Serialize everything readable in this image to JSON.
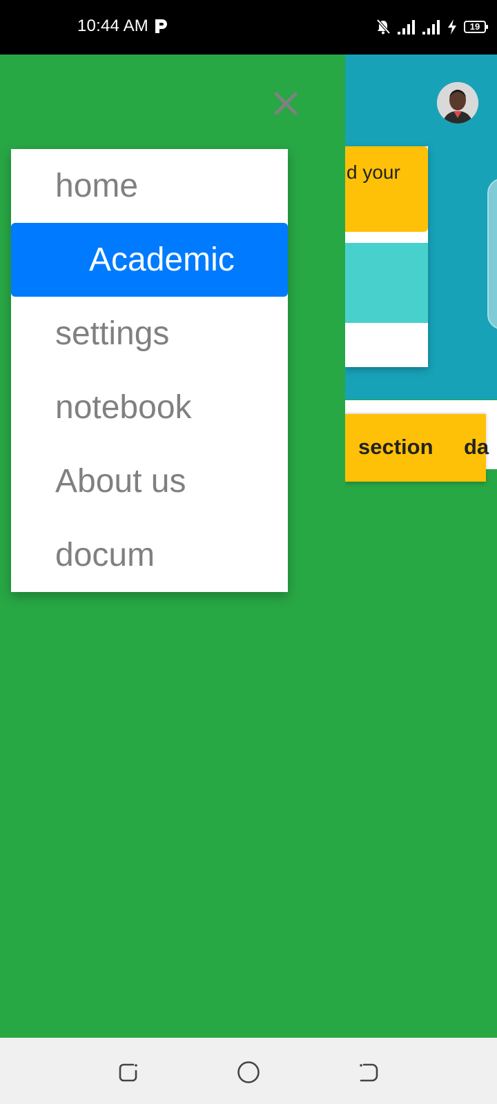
{
  "status_bar": {
    "time": "10:44 AM",
    "battery": "19",
    "icons": [
      "p-app-icon",
      "bell-muted-icon",
      "signal-icon",
      "signal-icon",
      "charging-icon",
      "battery-icon"
    ]
  },
  "drawer": {
    "close_icon": "close-icon",
    "items": [
      {
        "label": "home",
        "active": false
      },
      {
        "label": "Academic",
        "active": true
      },
      {
        "label": "settings",
        "active": false
      },
      {
        "label": "notebook",
        "active": false
      },
      {
        "label": "About us",
        "active": false
      },
      {
        "label": "docum",
        "active": false
      }
    ]
  },
  "background": {
    "card_text": "d your",
    "tabs": [
      "section",
      "da"
    ]
  },
  "nav_bar": {
    "buttons": [
      "recent-apps-icon",
      "home-icon",
      "back-icon"
    ]
  },
  "colors": {
    "drawer_bg": "#28a745",
    "active_item": "#007bff",
    "header_bg": "#17a2b8",
    "card_yellow": "#ffc107",
    "card_teal": "#48d1cc"
  }
}
